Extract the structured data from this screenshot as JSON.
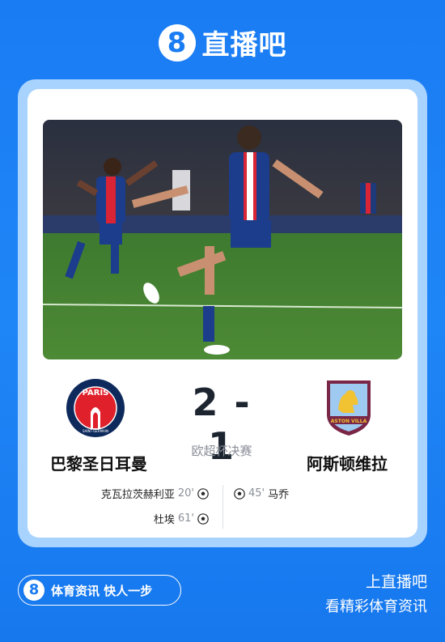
{
  "header": {
    "logo_mark": "8",
    "brand": "直播吧"
  },
  "match": {
    "home_team": "巴黎圣日耳曼",
    "away_team": "阿斯顿维拉",
    "score": "2 - 1",
    "competition": "欧超杯决赛",
    "home_crest_text": "PARIS",
    "home_crest_sub": "SAINT-GERMAIN",
    "away_crest_text": "ASTON VILLA",
    "home_goals": [
      {
        "player": "克瓦拉茨赫利亚",
        "minute": "20'"
      },
      {
        "player": "杜埃",
        "minute": "61'"
      }
    ],
    "away_goals": [
      {
        "player": "马乔",
        "minute": "45'"
      }
    ]
  },
  "footer": {
    "pill_mark": "8",
    "slogan": "体育资讯 快人一步",
    "title": "上直播吧",
    "subtitle": "看精彩体育资讯"
  },
  "icons": {
    "goal": "soccer-ball-icon"
  },
  "colors": {
    "brand_blue": "#1a7cf3",
    "psg_navy": "#0e2a5c",
    "psg_red": "#e0212b",
    "villa_claret": "#7a2646"
  }
}
